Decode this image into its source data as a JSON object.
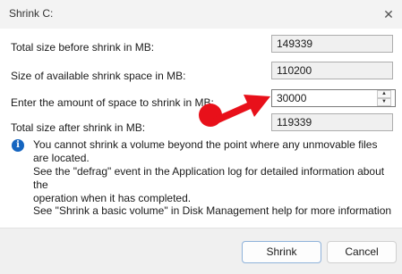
{
  "window": {
    "title": "Shrink C:",
    "close_glyph": "✕"
  },
  "rows": [
    {
      "label": "Total size before shrink in MB:",
      "value": "149339"
    },
    {
      "label": "Size of available shrink space in MB:",
      "value": "110200"
    },
    {
      "label": "Enter the amount of space to shrink in MB:",
      "value": "30000"
    },
    {
      "label": "Total size after shrink in MB:",
      "value": "119339"
    }
  ],
  "spinner": {
    "up": "▲",
    "down": "▼"
  },
  "info": {
    "icon_glyph": "i",
    "lines": [
      "You cannot shrink a volume beyond the point where any unmovable files are located.",
      "See the \"defrag\" event in the Application log for detailed information about the",
      "operation when it has completed."
    ]
  },
  "help": "See \"Shrink a basic volume\" in Disk Management help for more information",
  "buttons": {
    "shrink": "Shrink",
    "cancel": "Cancel"
  },
  "colors": {
    "accent_arrow": "#e8101a",
    "info_icon": "#1565c0"
  }
}
